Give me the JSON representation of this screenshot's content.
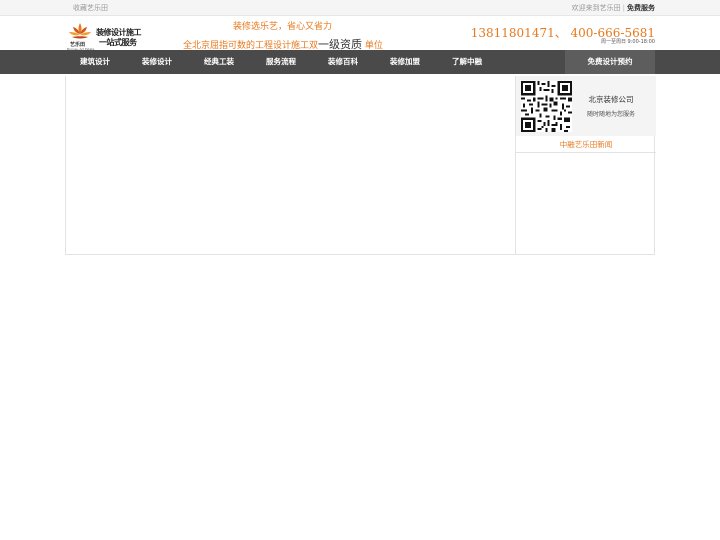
{
  "topbar": {
    "favorite": "收藏艺乐田",
    "welcome": "欢迎来到艺乐田",
    "free_service": "免费服务"
  },
  "logo": {
    "brand_name": "艺乐田",
    "brand_sub": "Bonneu Art Estate",
    "line1": "装修设计施工",
    "line2": "一站式服务"
  },
  "slogan": {
    "line1": "装修选乐艺，省心又省力",
    "line2_prefix": "全北京屈指可数的工程设计施工双",
    "line2_big": "一级资质",
    "line2_suffix": "单位"
  },
  "contact": {
    "phone": "13811801471、 400-666-5681",
    "hours": "周一至周日 9:00-18:00"
  },
  "nav": {
    "items": [
      "建筑设计",
      "装修设计",
      "经典工装",
      "服务流程",
      "装修百科",
      "装修加盟",
      "了解中融"
    ],
    "cta": "免费设计预约"
  },
  "sidebar": {
    "company": "北京装修公司",
    "service": "随时随地为您服务",
    "news_title": "中融艺乐田新闻"
  },
  "colors": {
    "accent": "#e8791d",
    "nav_bg": "#4a4a4a"
  }
}
